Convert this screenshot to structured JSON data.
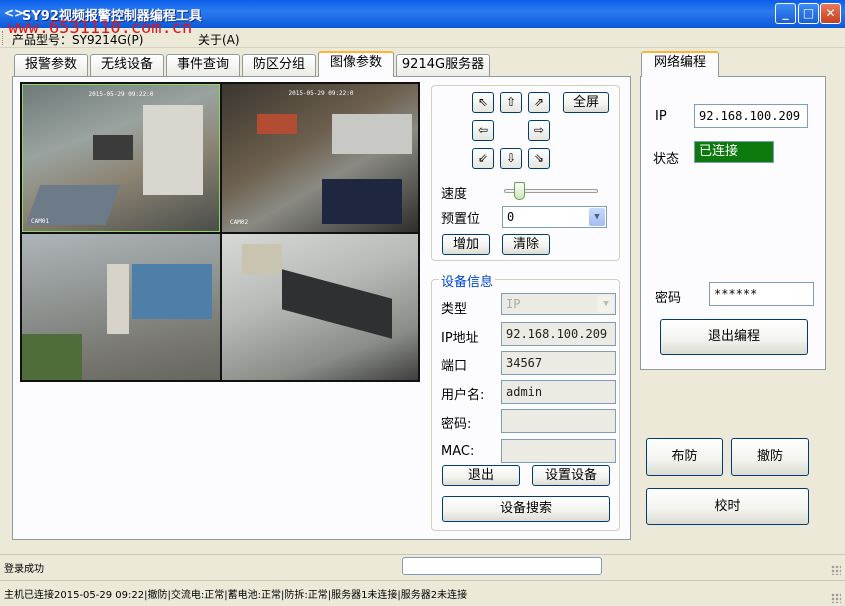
{
  "window": {
    "title": "SY92视频报警控制器编程工具"
  },
  "menu": {
    "items": [
      "产品型号：SY9214G(P)",
      "关于(A)"
    ],
    "watermark": "www.6531110.com.cn"
  },
  "tabs": [
    {
      "label": "报警参数"
    },
    {
      "label": "无线设备"
    },
    {
      "label": "事件查询"
    },
    {
      "label": "防区分组"
    },
    {
      "label": "图像参数",
      "active": true
    },
    {
      "label": "9214G服务器"
    }
  ],
  "video": {
    "cams": [
      {
        "timestamp": "2015-05-29 09:22:0",
        "label": "CAM01"
      },
      {
        "timestamp": "2015-05-29 09:22:0",
        "label": "CAM02"
      },
      {
        "timestamp": "",
        "label": ""
      },
      {
        "timestamp": "",
        "label": ""
      }
    ]
  },
  "ptz": {
    "fullscreen_label": "全屏",
    "speed_label": "速度",
    "speed_value": 0.1,
    "preset_label": "预置位",
    "preset_value": "0",
    "add_label": "增加",
    "clear_label": "清除"
  },
  "device_info": {
    "title": "设备信息",
    "type_label": "类型",
    "type_value": "IP",
    "ip_label": "IP地址",
    "ip_value": "92.168.100.209",
    "port_label": "端口",
    "port_value": "34567",
    "user_label": "用户名:",
    "user_value": "admin",
    "pwd_label": "密码:",
    "pwd_value": "",
    "mac_label": "MAC:",
    "mac_value": "",
    "exit_label": "退出",
    "setup_label": "设置设备",
    "search_label": "设备搜索"
  },
  "network": {
    "title": "网络编程",
    "ip_label": "IP",
    "ip_value": "92.168.100.209",
    "status_label": "状态",
    "status_value": "已连接",
    "pwd_label": "密码",
    "pwd_value": "******",
    "exit_label": "退出编程"
  },
  "actions": {
    "arm_label": "布防",
    "disarm_label": "撤防",
    "sync_time_label": "校时"
  },
  "statusbar": {
    "message": "登录成功",
    "progress": 0,
    "info": "主机已连接2015-05-29 09:22|撤防|交流电:正常|蓄电池:正常|防拆:正常|服务器1未连接|服务器2未连接"
  },
  "colors": {
    "titlebar": "#0a5ee8",
    "status_connected": "#0c7a0c",
    "groupbox_title": "#0046d5",
    "watermark": "#e0141a"
  }
}
